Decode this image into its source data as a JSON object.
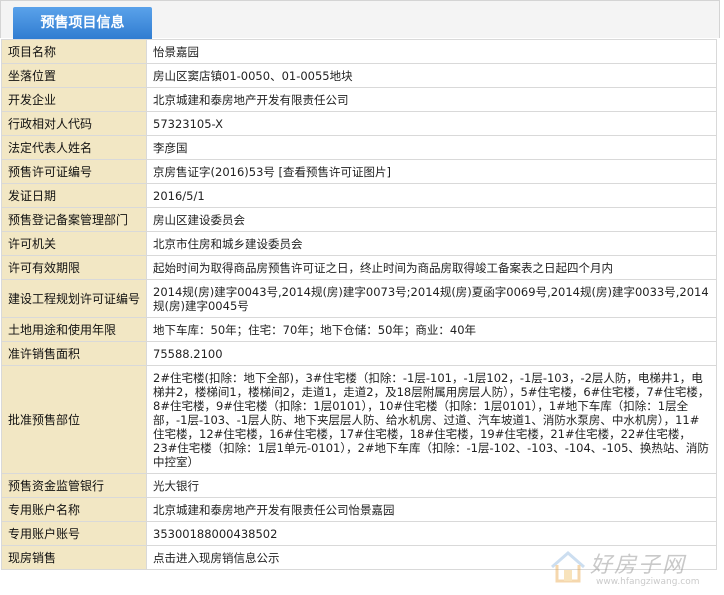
{
  "header": {
    "tab_title": "预售项目信息"
  },
  "rows": [
    {
      "label": "项目名称",
      "value": "怡景嘉园"
    },
    {
      "label": "坐落位置",
      "value": "房山区窦店镇01-0050、01-0055地块"
    },
    {
      "label": "开发企业",
      "value": "北京城建和泰房地产开发有限责任公司"
    },
    {
      "label": "行政相对人代码",
      "value": "57323105-X"
    },
    {
      "label": "法定代表人姓名",
      "value": "李彦国"
    },
    {
      "label": "预售许可证编号",
      "value": "京房售证字(2016)53号",
      "link": "[查看预售许可证图片]"
    },
    {
      "label": "发证日期",
      "value": "2016/5/1"
    },
    {
      "label": "预售登记备案管理部门",
      "value": "房山区建设委员会"
    },
    {
      "label": "许可机关",
      "value": "北京市住房和城乡建设委员会"
    },
    {
      "label": "许可有效期限",
      "value": "起始时间为取得商品房预售许可证之日，终止时间为商品房取得竣工备案表之日起四个月内"
    },
    {
      "label": "建设工程规划许可证编号",
      "value": "2014规(房)建字0043号,2014规(房)建字0073号;2014规(房)夏函字0069号,2014规(房)建字0033号,2014规(房)建字0045号"
    },
    {
      "label": "土地用途和使用年限",
      "value": "地下车库：50年；住宅：70年；地下仓储：50年；商业：40年"
    },
    {
      "label": "准许销售面积",
      "value": "75588.2100"
    },
    {
      "label": "批准预售部位",
      "value": "2#住宅楼(扣除：地下全部)，3#住宅楼（扣除：-1层-101，-1层102，-1层-103，-2层人防，电梯井1，电梯井2，楼梯间1，楼梯间2，走道1，走道2，及18层附属用房层人防），5#住宅楼，6#住宅楼，7#住宅楼，8#住宅楼，9#住宅楼（扣除：1层0101），10#住宅楼（扣除：1层0101），1#地下车库（扣除：1层全部，-1层-103、-1层人防、地下夹层层人防、给水机房、过道、汽车坡道1、消防水泵房、中水机房），11#住宅楼，12#住宅楼，16#住宅楼，17#住宅楼，18#住宅楼，19#住宅楼，21#住宅楼，22#住宅楼，23#住宅楼（扣除：1层1单元-0101），2#地下车库（扣除：-1层-102、-103、-104、-105、换热站、消防中控室）"
    },
    {
      "label": "预售资金监管银行",
      "value": "光大银行"
    },
    {
      "label": "专用账户名称",
      "value": "北京城建和泰房地产开发有限责任公司怡景嘉园"
    },
    {
      "label": "专用账户账号",
      "value": "35300188000438502"
    },
    {
      "label": "现房销售",
      "value": "点击进入现房销信息公示"
    }
  ],
  "watermark": {
    "text": "好房子网",
    "url": "www.hfangziwang.com"
  }
}
